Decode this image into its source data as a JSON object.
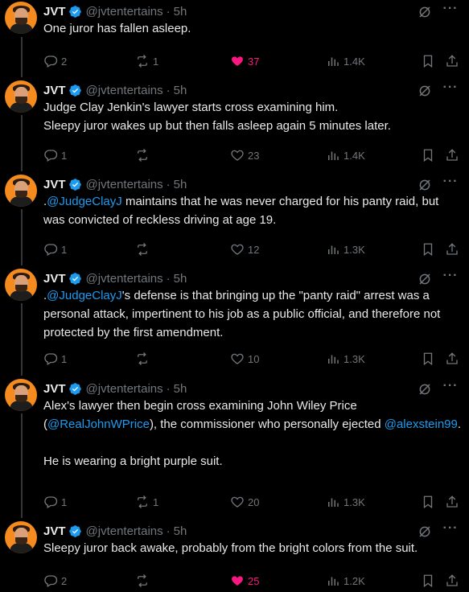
{
  "author": {
    "name": "JVT",
    "handle": "@jvtentertains",
    "separator": "·"
  },
  "colors": {
    "background": "#000000",
    "text": "#e7e9ea",
    "muted": "#71767b",
    "link": "#1d9bf0",
    "like_active": "#f91880",
    "verified": "#1d9bf0",
    "avatar_bg": "#f58a1f"
  },
  "tweets": [
    {
      "time": "5h",
      "paragraphs": [
        [
          {
            "t": "One juror has fallen asleep."
          }
        ]
      ],
      "reply_count": "2",
      "repost_count": "1",
      "like_count": "37",
      "liked": true,
      "view_count": "1.4K"
    },
    {
      "time": "5h",
      "paragraphs": [
        [
          {
            "t": "Judge Clay Jenkin's lawyer starts cross examining him."
          }
        ],
        [
          {
            "t": "Sleepy juror wakes up but then falls asleep again 5 minutes later."
          }
        ]
      ],
      "reply_count": "1",
      "repost_count": "",
      "like_count": "23",
      "liked": false,
      "view_count": "1.4K"
    },
    {
      "time": "5h",
      "paragraphs": [
        [
          {
            "t": "."
          },
          {
            "t": "@JudgeClayJ",
            "m": true
          },
          {
            "t": " maintains that he was never charged for his panty raid, but was convicted of reckless driving at age 19."
          }
        ]
      ],
      "reply_count": "1",
      "repost_count": "",
      "like_count": "12",
      "liked": false,
      "view_count": "1.3K"
    },
    {
      "time": "5h",
      "paragraphs": [
        [
          {
            "t": "."
          },
          {
            "t": "@JudgeClayJ",
            "m": true
          },
          {
            "t": "'s defense is that bringing up the \"panty raid\" arrest was a personal attack, impertinent to his job as a public official, and therefore not protected by the first amendment."
          }
        ]
      ],
      "reply_count": "1",
      "repost_count": "",
      "like_count": "10",
      "liked": false,
      "view_count": "1.3K"
    },
    {
      "time": "5h",
      "paragraphs": [
        [
          {
            "t": "Alex's lawyer then begin cross examining John Wiley Price ("
          },
          {
            "t": "@RealJohnWPrice",
            "m": true
          },
          {
            "t": "), the commissioner who personally ejected "
          },
          {
            "t": "@alexstein99",
            "m": true
          },
          {
            "t": "."
          }
        ],
        [],
        [
          {
            "t": "He is wearing a bright purple suit."
          }
        ]
      ],
      "reply_count": "1",
      "repost_count": "1",
      "like_count": "20",
      "liked": false,
      "view_count": "1.3K"
    },
    {
      "time": "5h",
      "paragraphs": [
        [
          {
            "t": "Sleepy juror back awake, probably from the bright colors from the suit."
          }
        ]
      ],
      "reply_count": "2",
      "repost_count": "",
      "like_count": "25",
      "liked": true,
      "view_count": "1.2K"
    }
  ]
}
